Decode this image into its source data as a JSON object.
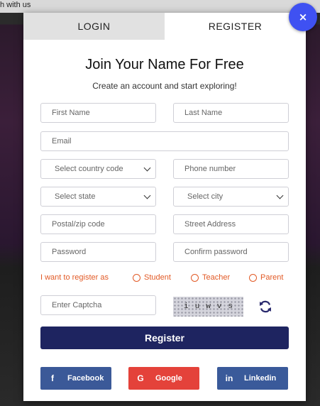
{
  "background": {
    "strip_text": "h with us"
  },
  "tabs": {
    "login": "LOGIN",
    "register": "REGISTER"
  },
  "close_label": "×",
  "form": {
    "title": "Join Your Name For Free",
    "subtitle": "Create an account and start exploring!",
    "first_name_placeholder": "First Name",
    "last_name_placeholder": "Last Name",
    "email_placeholder": "Email",
    "country_code_select": "Select country code",
    "phone_placeholder": "Phone number",
    "state_select": "Select state",
    "city_select": "Select city",
    "postal_placeholder": "Postal/zip code",
    "street_placeholder": "Street Address",
    "password_placeholder": "Password",
    "confirm_password_placeholder": "Confirm password",
    "register_as_label": "I want to register as",
    "roles": [
      "Student",
      "Teacher",
      "Parent"
    ],
    "captcha_placeholder": "Enter Captcha",
    "captcha_chars": [
      "i",
      "u",
      "w",
      "v",
      "s"
    ],
    "register_button": "Register"
  },
  "social": {
    "facebook": "Facebook",
    "google": "Google",
    "linkedin": "Linkedin"
  },
  "colors": {
    "accent_orange": "#e25a26",
    "register_navy": "#1e2460",
    "close_blue": "#3f51f2",
    "facebook": "#3b5998",
    "google": "#e4423a",
    "linkedin": "#3a5a9a"
  }
}
